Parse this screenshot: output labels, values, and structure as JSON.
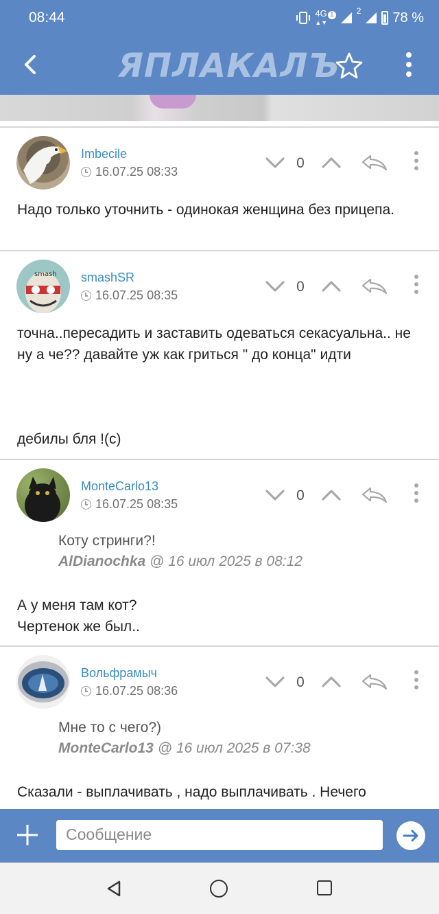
{
  "status": {
    "time": "08:44",
    "network": "4G",
    "sim_badge": "1",
    "sim2_badge": "2",
    "battery": "78 %"
  },
  "header": {
    "logo": "ЯПЛАКАЛЪ",
    "icons": [
      "back-arrow-icon",
      "star-icon",
      "more-vertical-icon"
    ]
  },
  "colors": {
    "header_bg": "#5b87c5",
    "username": "#3a8cc0",
    "text": "#222222"
  },
  "comments": [
    {
      "user": "Imbecile",
      "date": "16.07.25 08:33",
      "votes": "0",
      "text": "Надо только уточнить - одинокая женщина без прицепа."
    },
    {
      "user": "smashSR",
      "date": "16.07.25 08:35",
      "votes": "0",
      "text1": "точна..пересадить и заставить одеваться секасуальна.. не ну а че?? давайте уж как гриться \" до конца\" идти",
      "text2": "дебилы бля !(с)"
    },
    {
      "user": "MonteCarlo13",
      "date": "16.07.25 08:35",
      "votes": "0",
      "quote_text": "Коту стринги?!",
      "quote_author": "AlDianochka",
      "quote_meta": "@ 16 июл 2025 в 08:12",
      "text1": "А у меня там кот?",
      "text2": "Чертенок же был.."
    },
    {
      "user": "Вольфрамыч",
      "date": "16.07.25 08:36",
      "votes": "0",
      "quote_text": "Мне то с чего?)",
      "quote_author": "MonteCarlo13",
      "quote_meta": "@ 16 июл 2025 в 07:38",
      "text": "Сказали - выплачивать , надо выплачивать . Нечего"
    }
  ],
  "composer": {
    "placeholder": "Сообщение"
  }
}
